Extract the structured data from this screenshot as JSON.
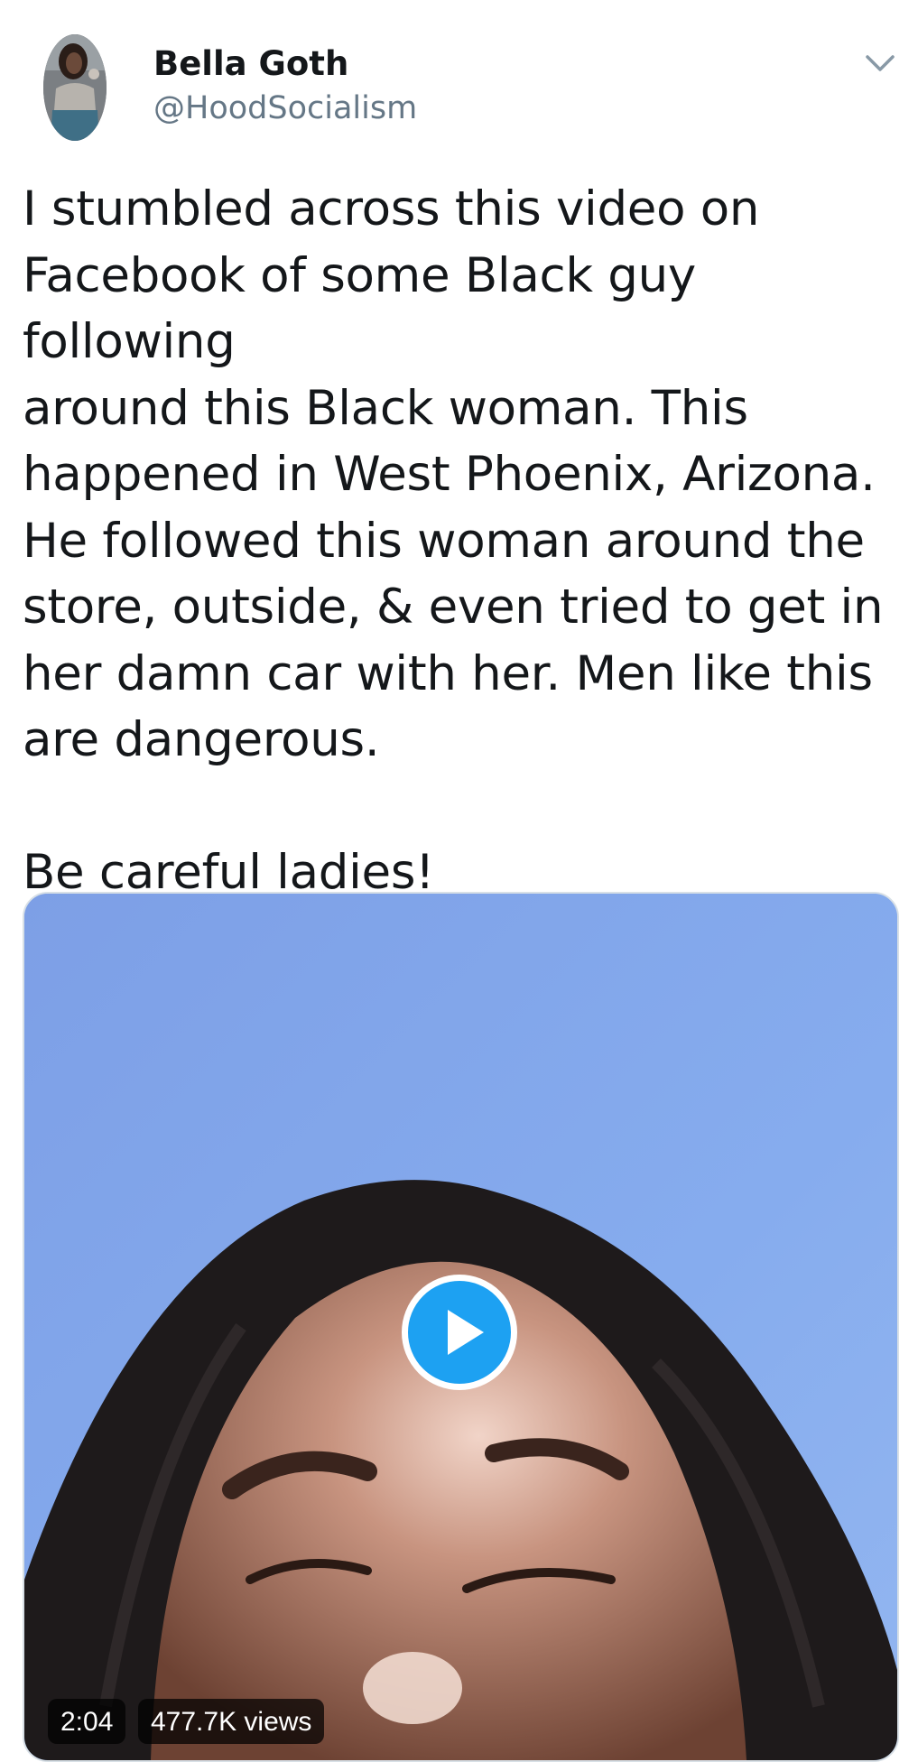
{
  "author": {
    "display_name": "Bella Goth",
    "handle": "@HoodSocialism"
  },
  "tweet": {
    "text": "I stumbled across this video on\nFacebook of some Black guy following\naround this Black woman. This\nhappened in West Phoenix, Arizona.\nHe followed this woman around the\nstore, outside, & even tried to get in\nher damn car with her. Men like this\nare dangerous.\n\nBe careful ladies!"
  },
  "media": {
    "type": "video",
    "duration": "2:04",
    "views": "477.7K views"
  },
  "icons": {
    "caret": "chevron-down-icon",
    "play": "play-icon"
  },
  "colors": {
    "accent": "#1da1f2",
    "secondary_text": "#657786",
    "primary_text": "#14171a"
  }
}
